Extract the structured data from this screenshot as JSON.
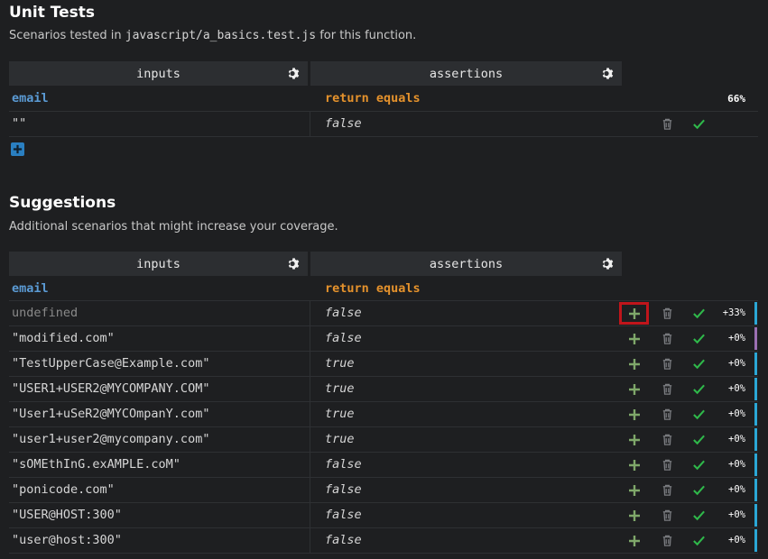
{
  "unit_tests": {
    "title": "Unit Tests",
    "desc_prefix": "Scenarios tested in ",
    "desc_file": "javascript/a_basics.test.js",
    "desc_suffix": " for this function.",
    "header_inputs": "inputs",
    "header_assertions": "assertions",
    "input_key": "email",
    "assertion_key": "return equals",
    "coverage": "66%",
    "rows": [
      {
        "input": "\"\"",
        "output": "false"
      }
    ]
  },
  "suggestions": {
    "title": "Suggestions",
    "desc": "Additional scenarios that might increase your coverage.",
    "header_inputs": "inputs",
    "header_assertions": "assertions",
    "input_key": "email",
    "assertion_key": "return equals",
    "rows": [
      {
        "input": "undefined",
        "output": "false",
        "delta": "+33%",
        "bar_color": "#2aa7d6",
        "undefined": true
      },
      {
        "input": "\"modified.com\"",
        "output": "false",
        "delta": "+0%",
        "bar_color": "#9b6fb2"
      },
      {
        "input": "\"TestUpperCase@Example.com\"",
        "output": "true",
        "delta": "+0%",
        "bar_color": "#2aa7d6"
      },
      {
        "input": "\"USER1+USER2@MYCOMPANY.COM\"",
        "output": "true",
        "delta": "+0%",
        "bar_color": "#2aa7d6"
      },
      {
        "input": "\"User1+uSeR2@MYCOmpanY.com\"",
        "output": "true",
        "delta": "+0%",
        "bar_color": "#2aa7d6"
      },
      {
        "input": "\"user1+user2@mycompany.com\"",
        "output": "true",
        "delta": "+0%",
        "bar_color": "#2aa7d6"
      },
      {
        "input": "\"sOMEthInG.exAMPLE.coM\"",
        "output": "false",
        "delta": "+0%",
        "bar_color": "#2aa7d6"
      },
      {
        "input": "\"ponicode.com\"",
        "output": "false",
        "delta": "+0%",
        "bar_color": "#2aa7d6"
      },
      {
        "input": "\"USER@HOST:300\"",
        "output": "false",
        "delta": "+0%",
        "bar_color": "#2aa7d6"
      },
      {
        "input": "\"user@host:300\"",
        "output": "false",
        "delta": "+0%",
        "bar_color": "#2aa7d6"
      }
    ]
  },
  "colors": {
    "background": "#1e1f21",
    "header_bg": "#2c2e31",
    "input_key": "#5b9bd5",
    "assertion_key": "#e5922c",
    "check": "#2fb84a",
    "plus": "#7fa86a",
    "highlight": "#c0151b",
    "add_button": "#2a7fc1"
  },
  "icons": [
    "gear-icon",
    "trash-icon",
    "check-icon",
    "plus-icon",
    "add-scenario-icon"
  ]
}
